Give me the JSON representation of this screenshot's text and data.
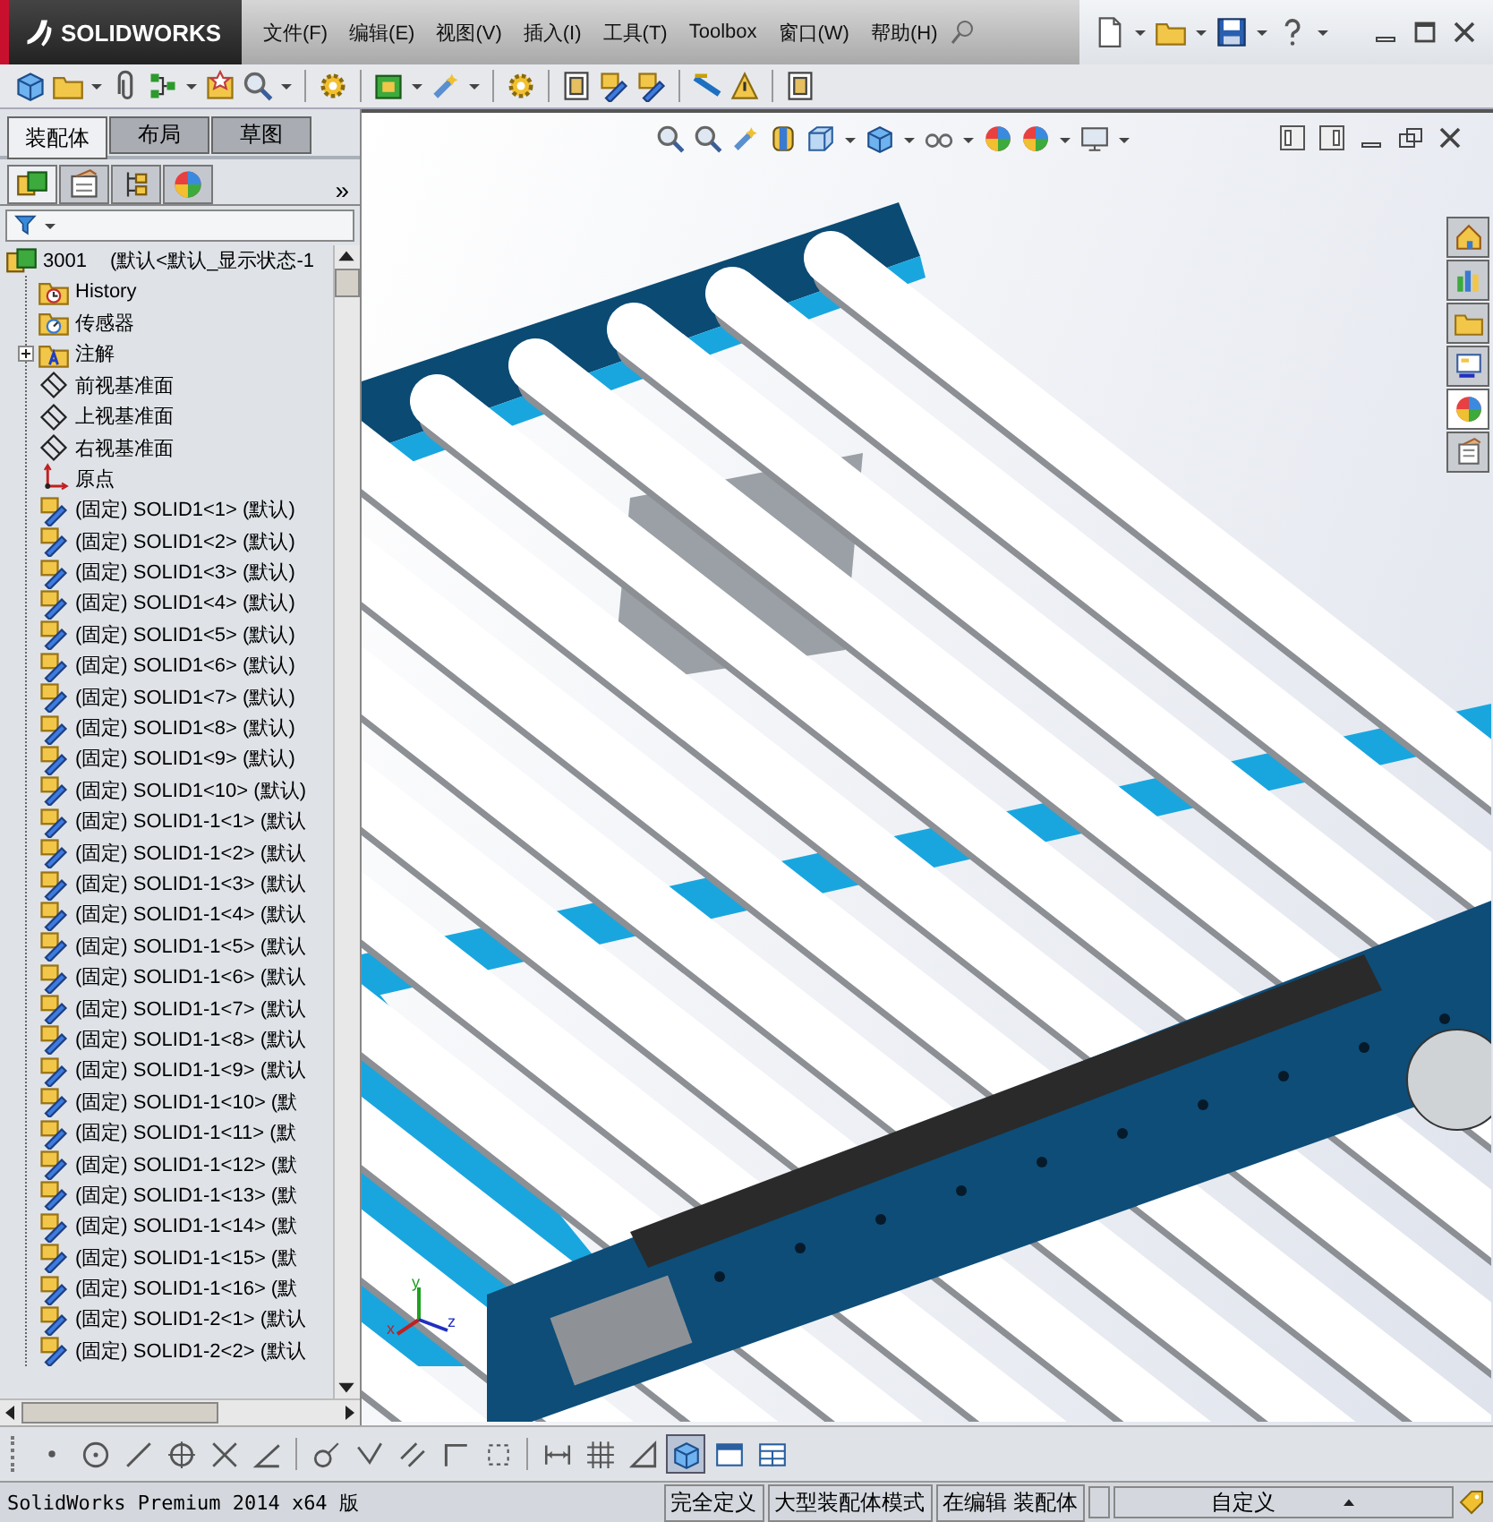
{
  "window": {
    "logo": "SOLIDWORKS"
  },
  "menu": [
    "文件(F)",
    "编辑(E)",
    "视图(V)",
    "插入(I)",
    "工具(T)",
    "Toolbox",
    "窗口(W)",
    "帮助(H)"
  ],
  "panel_tabs": [
    {
      "label": "装配体",
      "selected": true
    },
    {
      "label": "布局",
      "selected": false
    },
    {
      "label": "草图",
      "selected": false
    }
  ],
  "manager_tabs": [
    {
      "kind": "feature",
      "selected": true
    },
    {
      "kind": "property",
      "selected": false
    },
    {
      "kind": "config",
      "selected": false
    },
    {
      "kind": "display",
      "selected": false
    }
  ],
  "manager_more": "»",
  "tree": {
    "label": "3001",
    "config": "(默认<默认_显示状态-1",
    "children": [
      {
        "kind": "history",
        "label": "History"
      },
      {
        "kind": "sensor",
        "label": "传感器"
      },
      {
        "kind": "annotation",
        "label": "注解",
        "expanded": false
      },
      {
        "kind": "plane",
        "label": "前视基准面"
      },
      {
        "kind": "plane",
        "label": "上视基准面"
      },
      {
        "kind": "plane",
        "label": "右视基准面"
      },
      {
        "kind": "origin",
        "label": "原点"
      },
      {
        "kind": "part",
        "label": "(固定) SOLID1<1> (默认)"
      },
      {
        "kind": "part",
        "label": "(固定) SOLID1<2> (默认)"
      },
      {
        "kind": "part",
        "label": "(固定) SOLID1<3> (默认)"
      },
      {
        "kind": "part",
        "label": "(固定) SOLID1<4> (默认)"
      },
      {
        "kind": "part",
        "label": "(固定) SOLID1<5> (默认)"
      },
      {
        "kind": "part",
        "label": "(固定) SOLID1<6> (默认)"
      },
      {
        "kind": "part",
        "label": "(固定) SOLID1<7> (默认)"
      },
      {
        "kind": "part",
        "label": "(固定) SOLID1<8> (默认)"
      },
      {
        "kind": "part",
        "label": "(固定) SOLID1<9> (默认)"
      },
      {
        "kind": "part",
        "label": "(固定) SOLID1<10> (默认)"
      },
      {
        "kind": "part",
        "label": "(固定) SOLID1-1<1> (默认"
      },
      {
        "kind": "part",
        "label": "(固定) SOLID1-1<2> (默认"
      },
      {
        "kind": "part",
        "label": "(固定) SOLID1-1<3> (默认"
      },
      {
        "kind": "part",
        "label": "(固定) SOLID1-1<4> (默认"
      },
      {
        "kind": "part",
        "label": "(固定) SOLID1-1<5> (默认"
      },
      {
        "kind": "part",
        "label": "(固定) SOLID1-1<6> (默认"
      },
      {
        "kind": "part",
        "label": "(固定) SOLID1-1<7> (默认"
      },
      {
        "kind": "part",
        "label": "(固定) SOLID1-1<8> (默认"
      },
      {
        "kind": "part",
        "label": "(固定) SOLID1-1<9> (默认"
      },
      {
        "kind": "part",
        "label": "(固定) SOLID1-1<10> (默"
      },
      {
        "kind": "part",
        "label": "(固定) SOLID1-1<11> (默"
      },
      {
        "kind": "part",
        "label": "(固定) SOLID1-1<12> (默"
      },
      {
        "kind": "part",
        "label": "(固定) SOLID1-1<13> (默"
      },
      {
        "kind": "part",
        "label": "(固定) SOLID1-1<14> (默"
      },
      {
        "kind": "part",
        "label": "(固定) SOLID1-1<15> (默"
      },
      {
        "kind": "part",
        "label": "(固定) SOLID1-1<16> (默"
      },
      {
        "kind": "part",
        "label": "(固定) SOLID1-2<1> (默认"
      },
      {
        "kind": "part",
        "label": "(固定) SOLID1-2<2> (默认"
      }
    ]
  },
  "triad_labels": [
    "x",
    "y",
    "z"
  ],
  "task_pane": [
    {
      "kind": "home",
      "selected": false
    },
    {
      "kind": "library",
      "selected": false
    },
    {
      "kind": "folder",
      "selected": false
    },
    {
      "kind": "palette",
      "selected": false
    },
    {
      "kind": "appearance",
      "selected": true
    },
    {
      "kind": "properties",
      "selected": false
    }
  ],
  "sketch_toolbar": [
    {
      "kind": "point",
      "selected": false
    },
    {
      "kind": "circle",
      "selected": false
    },
    {
      "kind": "line",
      "selected": false
    },
    {
      "kind": "polygon",
      "selected": false
    },
    {
      "kind": "trim",
      "selected": false
    },
    {
      "kind": "angle",
      "selected": false
    },
    {
      "kind": "fillet",
      "selected": false
    },
    {
      "kind": "chamfer",
      "selected": false
    },
    {
      "kind": "parallel",
      "selected": false
    },
    {
      "kind": "corner",
      "selected": false
    },
    {
      "kind": "rect",
      "selected": false
    },
    {
      "kind": "dimension",
      "selected": false
    },
    {
      "kind": "grid",
      "selected": false
    },
    {
      "kind": "triangle",
      "selected": false
    },
    {
      "kind": "cube",
      "selected": true
    },
    {
      "kind": "window",
      "selected": false
    },
    {
      "kind": "table",
      "selected": false
    }
  ],
  "status_bar": {
    "product": "SolidWorks Premium 2014 x64 版",
    "fields": [
      "完全定义",
      "大型装配体模式",
      "在编辑 装配体"
    ],
    "units": "自定义"
  }
}
